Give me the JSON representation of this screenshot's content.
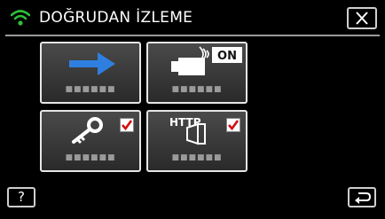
{
  "header": {
    "title": "DOĞRUDAN İZLEME",
    "wifi_icon": "wifi-icon",
    "close_icon": "close-icon"
  },
  "tiles": [
    {
      "icon": "arrow-right-icon",
      "label": "■■■■■■"
    },
    {
      "icon": "camera-wireless-on-icon",
      "badge": "ON",
      "label": "■■■■■■"
    },
    {
      "icon": "key-icon",
      "checked": true,
      "label": "■■■■■■"
    },
    {
      "icon": "http-door-icon",
      "badge": "HTTP",
      "checked": true,
      "label": "■■■■■■"
    }
  ],
  "footer": {
    "help_label": "?",
    "back_icon": "back-return-icon"
  },
  "colors": {
    "background": "#000000",
    "wifi": "#2fbf3a",
    "arrow": "#2f7fe0",
    "check": "#d01010"
  }
}
